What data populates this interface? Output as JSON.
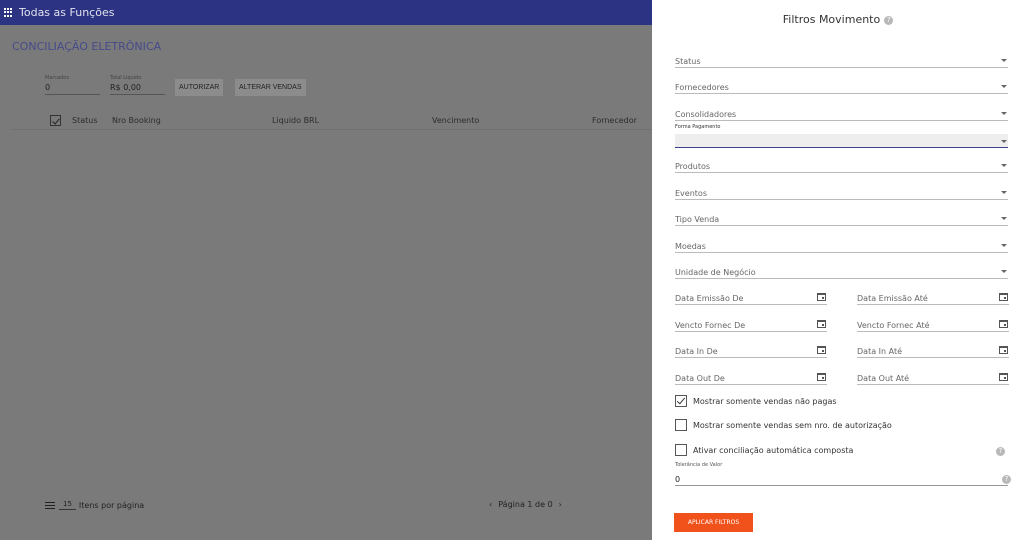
{
  "header": {
    "title": "Todas as Funções"
  },
  "page": {
    "title": "CONCILIAÇÃO ELETRÔNICA",
    "marcados_label": "Marcados",
    "marcados_value": "0",
    "total_label": "Total Liquido",
    "total_value": "R$ 0,00",
    "autorizar_label": "AUTORIZAR",
    "alterar_label": "ALTERAR VENDAS",
    "columns": [
      "Status",
      "Nro Booking",
      "Liquido BRL",
      "Vencimento",
      "Fornecedor"
    ],
    "per_page_value": "15",
    "per_page_label": "Itens por página",
    "pagination_text": "Página 1 de 0"
  },
  "drawer": {
    "title": "Filtros Movimento",
    "selects": [
      "Status",
      "Fornecedores",
      "Consolidadores"
    ],
    "forma_pagamento_label": "Forma Pagamento",
    "selects2": [
      "Produtos",
      "Eventos",
      "Tipo Venda",
      "Moedas",
      "Unidade de Negócio"
    ],
    "dates": [
      [
        "Data Emissão De",
        "Data Emissão Até"
      ],
      [
        "Vencto Fornec De",
        "Vencto Fornec Até"
      ],
      [
        "Data In De",
        "Data In Até"
      ],
      [
        "Data Out De",
        "Data Out Até"
      ]
    ],
    "checkboxes": [
      {
        "label": "Mostrar somente vendas não pagas",
        "checked": true
      },
      {
        "label": "Mostrar somente vendas sem nro. de autorização",
        "checked": false
      },
      {
        "label": "Ativar conciliação automática composta",
        "checked": false
      }
    ],
    "tolerancia_label": "Tolerância de Valor",
    "tolerancia_value": "0",
    "apply_label": "APLICAR FILTROS"
  }
}
